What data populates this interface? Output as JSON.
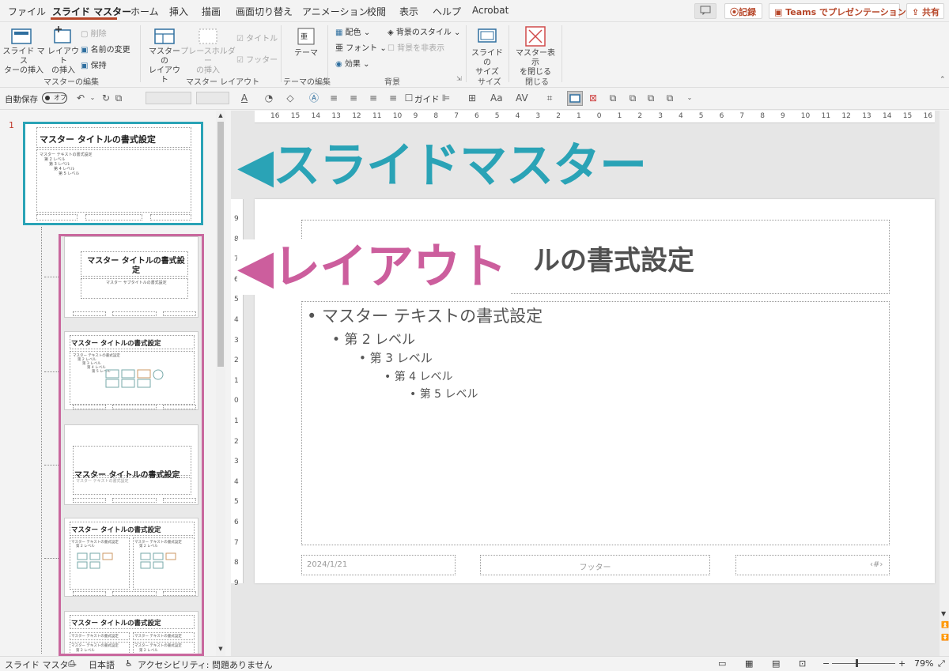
{
  "menu": {
    "tabs": [
      "ファイル",
      "スライド マスター",
      "ホーム",
      "挿入",
      "描画",
      "画面切り替え",
      "アニメーション",
      "校閲",
      "表示",
      "ヘルプ",
      "Acrobat"
    ]
  },
  "topright": {
    "comment_icon": "comment-icon",
    "record": "記録",
    "teams": "Teams でプレゼンテーション",
    "share": "共有"
  },
  "ribbon": {
    "insert_master": "スライド マス\nターの挿入",
    "insert_layout": "レイアウト\nの挿入",
    "delete": "削除",
    "rename": "名前の変更",
    "preserve": "保持",
    "master_layout": "マスターの\nレイアウト",
    "insert_placeholder": "プレースホルダー\nの挿入",
    "title_check": "タイトル",
    "footer_check": "フッター",
    "theme": "テーマ",
    "colors": "配色",
    "fonts": "フォント",
    "effects": "効果",
    "bg_styles": "背景のスタイル",
    "hide_bg": "背景を非表示",
    "slide_size": "スライドの\nサイズ",
    "close_master": "マスター表示\nを閉じる",
    "groups": [
      "マスターの編集",
      "マスター レイアウト",
      "テーマの編集",
      "背景",
      "サイズ",
      "閉じる"
    ]
  },
  "qat": {
    "autosave": "自動保存",
    "toggle": "オフ",
    "guide": "ガイド"
  },
  "thumbs": {
    "num": "1",
    "master_title": "マスター タイトルの書式設定",
    "master_text": "マスター テキストの書式設定",
    "lv2": "第 2 レベル",
    "lv3": "第 3 レベル",
    "lv4": "第 4 レベル",
    "lv5": "第 5 レベル",
    "t1_title": "マスター タイトルの書式設定",
    "t1_sub": "マスター サブタイトルの書式設定",
    "t2_title": "マスター タイトルの書式設定",
    "t3_title": "マスター タイトルの書式設定",
    "t4_title": "マスター タイトルの書式設定",
    "t5_title": "マスター タイトルの書式設定"
  },
  "callouts": {
    "master": "◀スライドマスター",
    "layout": "◀レイアウト",
    "master_color": "#2aa3b6",
    "layout_color": "#cc5e9d"
  },
  "ruler": {
    "h": [
      "16",
      "15",
      "14",
      "13",
      "12",
      "11",
      "10",
      "9",
      "8",
      "7",
      "6",
      "5",
      "4",
      "3",
      "2",
      "1",
      "0",
      "1",
      "2",
      "3",
      "4",
      "5",
      "6",
      "7",
      "8",
      "9",
      "10",
      "11",
      "12",
      "13",
      "14",
      "15",
      "16"
    ],
    "v": [
      "9",
      "8",
      "7",
      "6",
      "5",
      "4",
      "3",
      "2",
      "1",
      "0",
      "1",
      "2",
      "3",
      "4",
      "5",
      "6",
      "7",
      "8",
      "9"
    ]
  },
  "slide": {
    "title_tail": "ルの書式設定",
    "body": [
      "• マスター テキストの書式設定",
      "• 第 2 レベル",
      "• 第 3 レベル",
      "• 第 4 レベル",
      "• 第 5 レベル"
    ],
    "date": "2024/1/21",
    "footer": "フッター",
    "page": "‹#›"
  },
  "status": {
    "mode": "スライド マスター",
    "lang": "日本語",
    "access": "アクセシビリティ: 問題ありません",
    "zoom": "79%"
  }
}
